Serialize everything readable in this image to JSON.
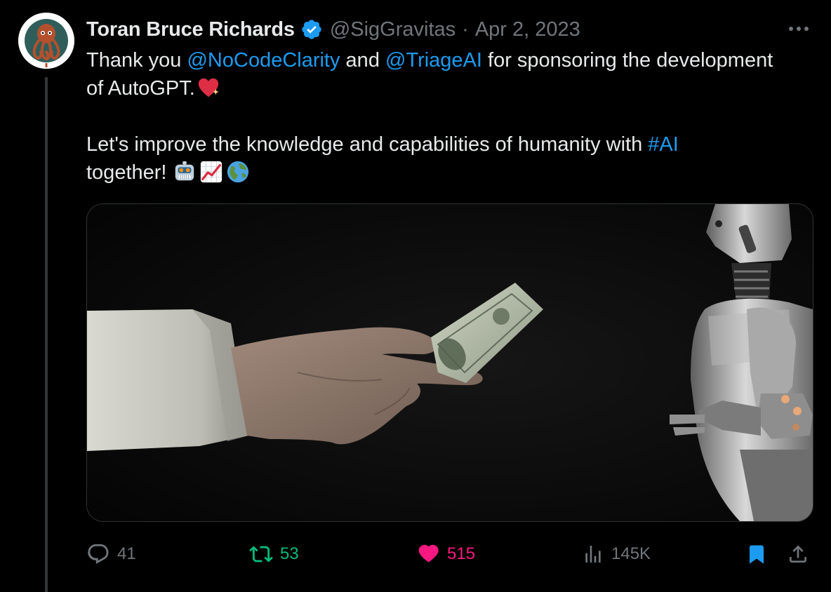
{
  "tweet": {
    "author_name": "Toran Bruce Richards",
    "handle": "@SigGravitas",
    "separator": "·",
    "date": "Apr 2, 2023",
    "text": {
      "line1_a": "Thank you ",
      "mention1": "@NoCodeClarity",
      "line1_b": " and ",
      "mention2": "@TriageAI",
      "line1_c": " for  sponsoring the development",
      "line2": "of AutoGPT.",
      "line3_a": "Let's improve the knowledge and capabilities of humanity with ",
      "hashtag": "#AI",
      "line4": "together! "
    },
    "emojis": [
      "robot-emoji",
      "chart-increasing-emoji",
      "globe-emoji"
    ],
    "media": {
      "description_icons": [
        "hand-holding-banknote",
        "robot"
      ]
    }
  },
  "actions": {
    "replies": "41",
    "retweets": "53",
    "likes": "515",
    "views": "145K"
  },
  "colors": {
    "link": "#1d9bf0",
    "muted": "#71767b",
    "retweet": "#00ba7c",
    "like": "#f91880",
    "bookmark": "#1d9bf0",
    "verified": "#1d9bf0"
  }
}
